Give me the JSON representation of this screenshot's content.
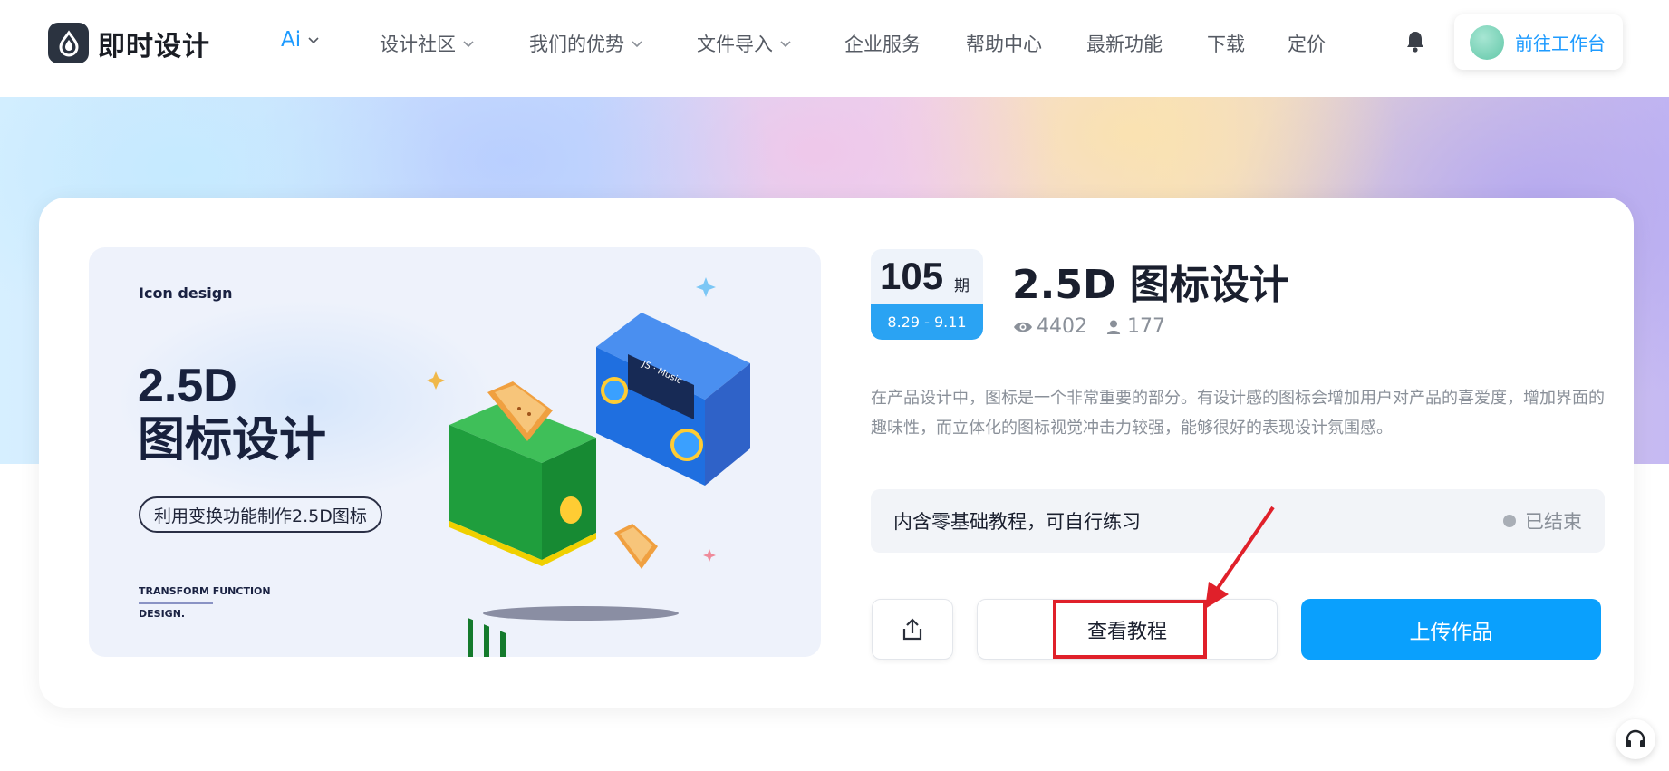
{
  "brand": {
    "name": "即时设计"
  },
  "nav": {
    "items": [
      {
        "label": "Ai",
        "has_dropdown": true
      },
      {
        "label": "设计社区",
        "has_dropdown": true
      },
      {
        "label": "我们的优势",
        "has_dropdown": true
      },
      {
        "label": "文件导入",
        "has_dropdown": true
      },
      {
        "label": "企业服务",
        "has_dropdown": false
      },
      {
        "label": "帮助中心",
        "has_dropdown": false
      },
      {
        "label": "最新功能",
        "has_dropdown": false
      },
      {
        "label": "下载",
        "has_dropdown": false
      },
      {
        "label": "定价",
        "has_dropdown": false
      }
    ],
    "workbench_label": "前往工作台",
    "icons": {
      "notification": "bell-icon"
    }
  },
  "cover": {
    "kicker": "Icon design",
    "line1": "2.5D",
    "line2": "图标设计",
    "pill": "利用变换功能制作2.5D图标",
    "footer1": "TRANSFORM FUNCTION",
    "footer2": "DESIGN.",
    "radio_screen_text": "JS · Music"
  },
  "event": {
    "issue_number": "105",
    "issue_unit": "期",
    "dates": "8.29 - 9.11",
    "title": "2.5D 图标设计",
    "views": "4402",
    "participants": "177",
    "description": "在产品设计中，图标是一个非常重要的部分。有设计感的图标会增加用户对产品的喜爱度，增加界面的趣味性，而立体化的图标视觉冲击力较强，能够很好的表现设计氛围感。",
    "info_text": "内含零基础教程，可自行练习",
    "status": "已结束"
  },
  "actions": {
    "tutorial_label": "查看教程",
    "upload_label": "上传作品"
  },
  "colors": {
    "accent": "#0aa0fd",
    "annotation": "#e0202a"
  }
}
